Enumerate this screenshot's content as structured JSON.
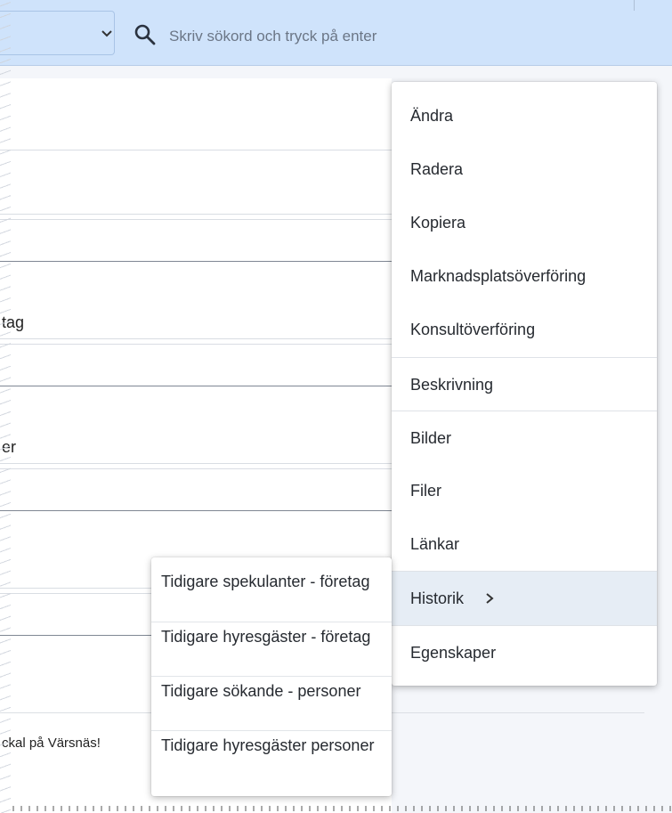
{
  "search": {
    "placeholder": "Skriv sökord och tryck på enter"
  },
  "content": {
    "partial_labels": [
      "tag",
      "er"
    ],
    "bottom_text": "ckal på Värsnäs!"
  },
  "menu": {
    "items": [
      {
        "label": "Ändra"
      },
      {
        "label": "Radera"
      },
      {
        "label": "Kopiera"
      },
      {
        "label": "Marknadsplatsöverföring"
      },
      {
        "label": "Konsultöverföring"
      },
      {
        "label": "Beskrivning"
      },
      {
        "label": "Bilder"
      },
      {
        "label": "Filer"
      },
      {
        "label": "Länkar"
      },
      {
        "label": "Historik",
        "has_submenu": true,
        "active": true
      },
      {
        "label": "Egenskaper"
      }
    ]
  },
  "submenu": {
    "items": [
      {
        "label": "Tidigare spekulanter - företag"
      },
      {
        "label": "Tidigare hyresgäster - företag"
      },
      {
        "label": "Tidigare sökande - personer"
      },
      {
        "label": "Tidigare hyresgäster personer"
      }
    ]
  },
  "colors": {
    "topbar": "#cfe3fb",
    "active_item": "#e6edf5"
  }
}
